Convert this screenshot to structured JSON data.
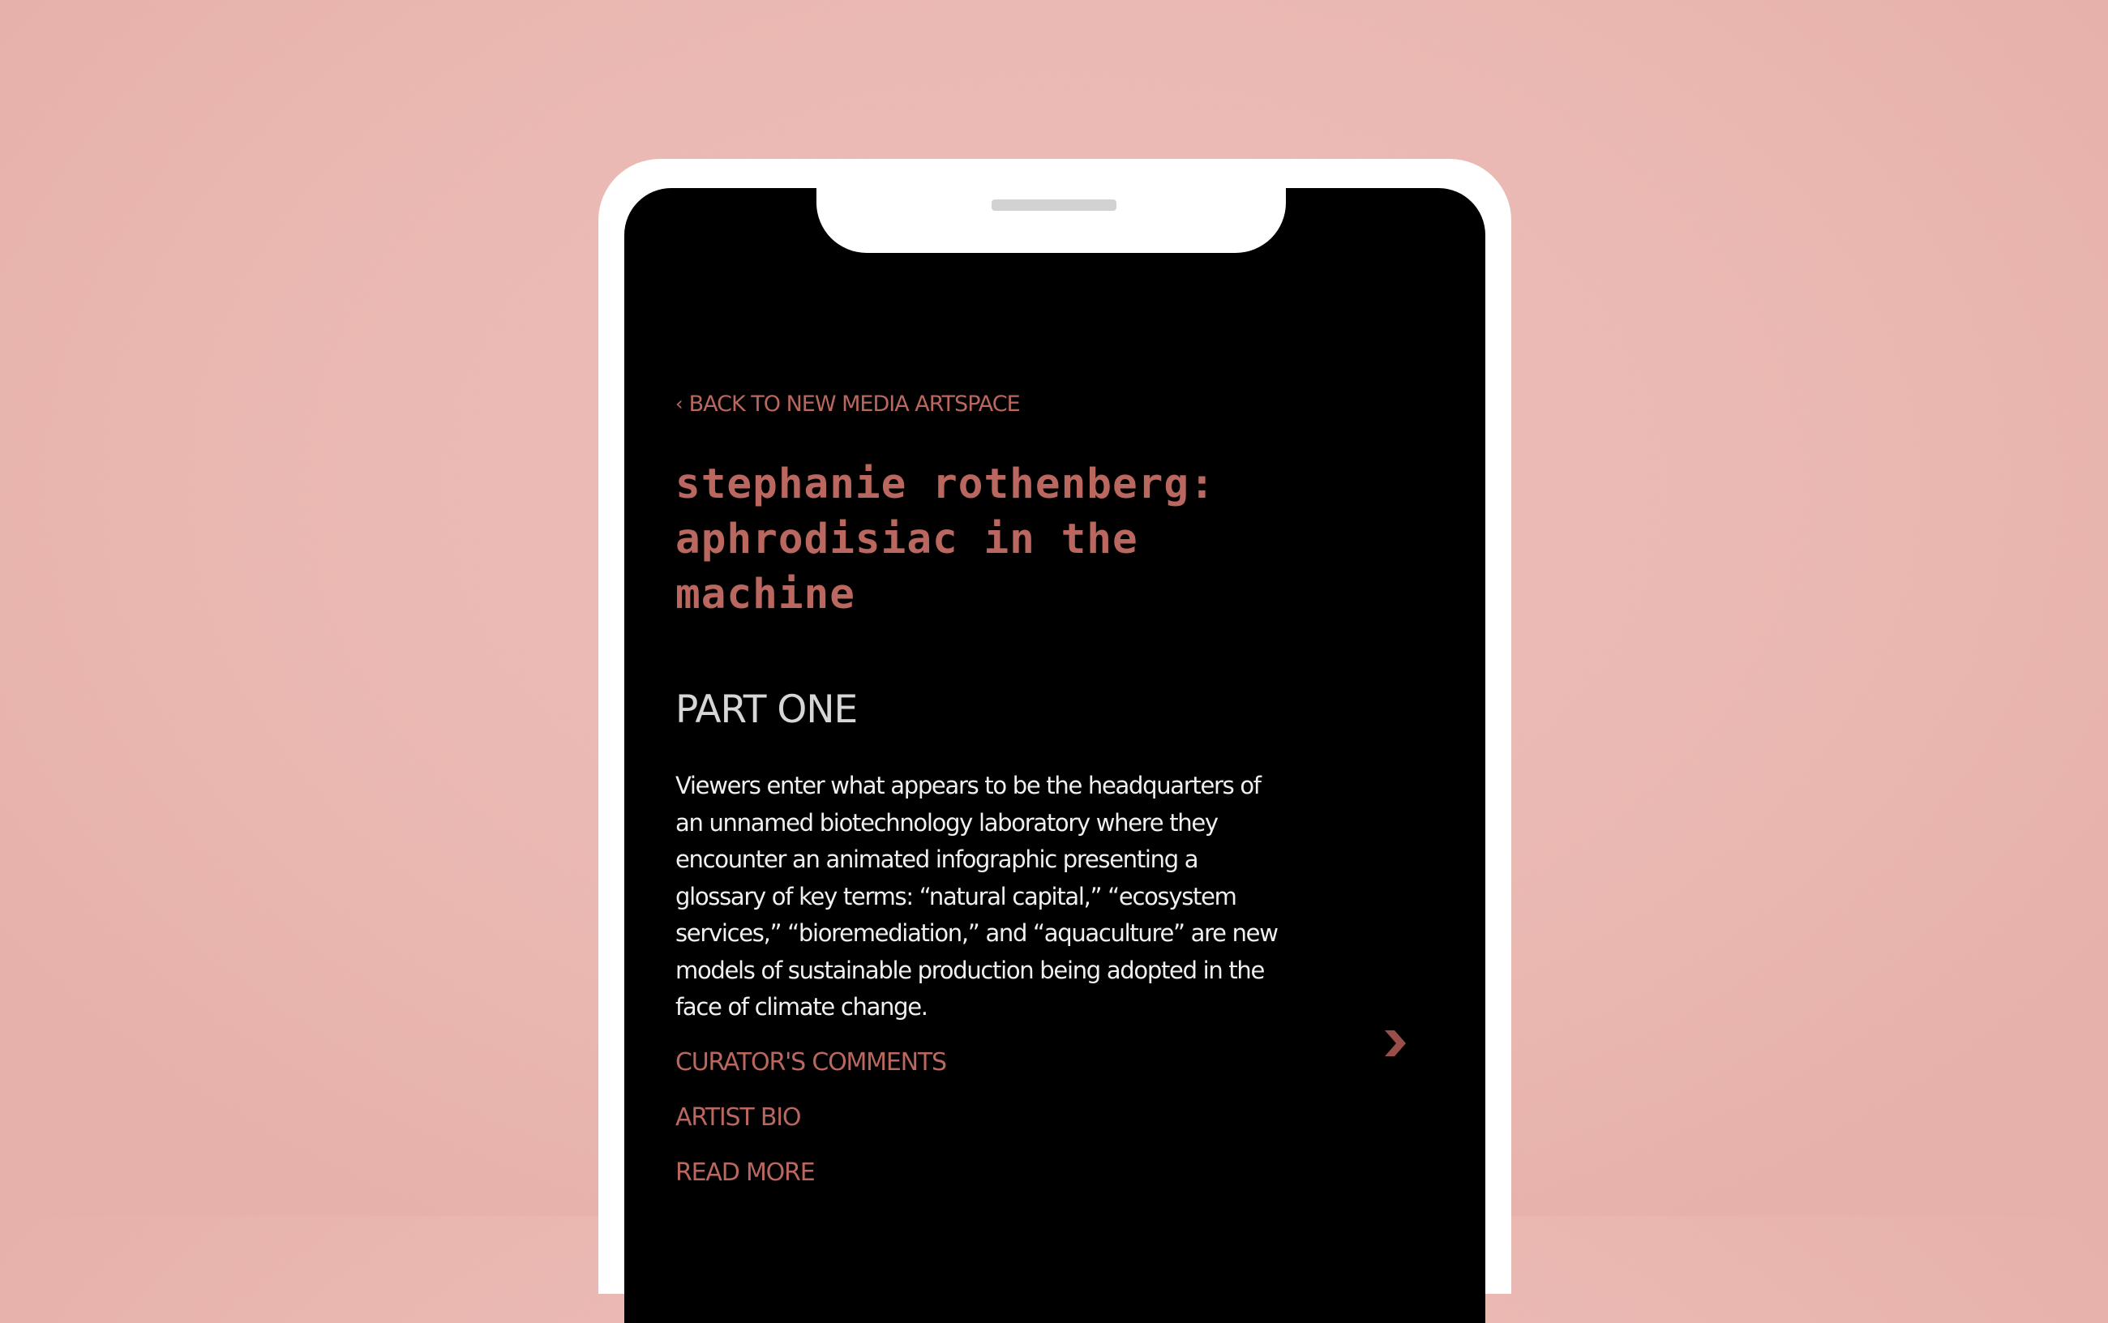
{
  "back_link": {
    "icon": "chevron-left-icon",
    "label": "BACK TO NEW MEDIA ARTSPACE"
  },
  "title": {
    "line1": "stephanie rothenberg:",
    "line2": "aphrodisiac in the machine"
  },
  "section_heading": "PART ONE",
  "description": [
    "Viewers enter what appears to be the headquarters of",
    "an unnamed biotechnology laboratory where they",
    "encounter an animated infographic presenting a",
    "glossary of key terms: “natural capital,” “ecosystem",
    "services,” “bioremediation,” and “aquaculture” are new",
    "models of sustainable production being adopted in the",
    "face of climate change."
  ],
  "links": {
    "curators_comments": "CURATOR'S COMMENTS",
    "artist_bio": "ARTIST BIO",
    "read_more": "READ MORE"
  },
  "next_icon": "chevron-right-icon",
  "colors": {
    "background": "#ebb9b3",
    "screen": "#000000",
    "accent": "#b9675f",
    "heading": "#d6d6d6",
    "body_text": "#f0f0f0"
  }
}
